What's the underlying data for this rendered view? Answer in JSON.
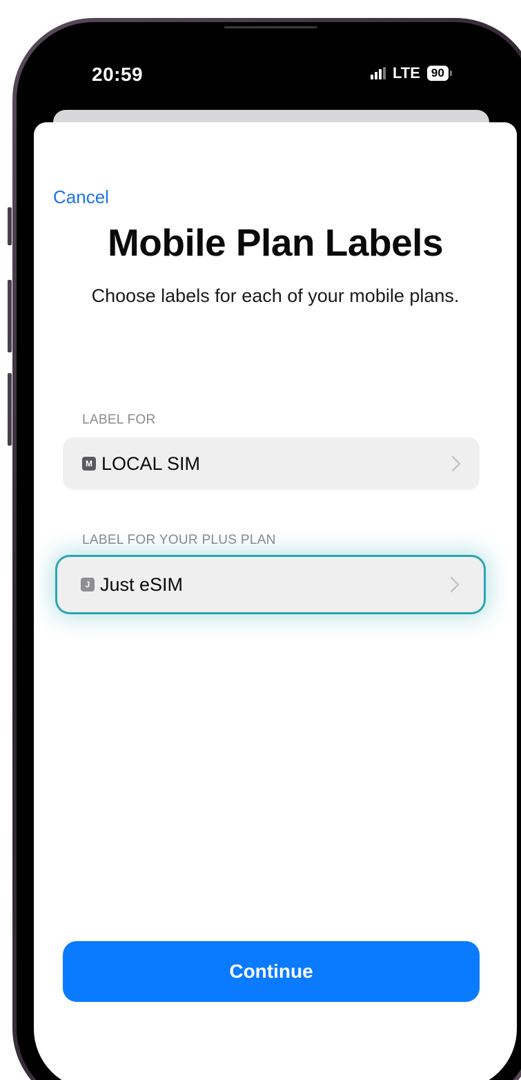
{
  "status_bar": {
    "time": "20:59",
    "network": "LTE",
    "battery": "90"
  },
  "sheet": {
    "cancel_label": "Cancel",
    "title": "Mobile Plan Labels",
    "subtitle": "Choose labels for each of your mobile plans.",
    "sections": [
      {
        "header": "LABEL FOR",
        "badge": "M",
        "value": "LOCAL SIM"
      },
      {
        "header": "LABEL FOR YOUR PLUS PLAN",
        "badge": "J",
        "value": "Just eSIM"
      }
    ],
    "continue_label": "Continue"
  },
  "colors": {
    "accent": "#0a7bff",
    "link": "#1a73e8",
    "highlight": "#2aa6b0",
    "badge_primary": "#5a5a5e",
    "badge_secondary": "#8e8e93"
  }
}
